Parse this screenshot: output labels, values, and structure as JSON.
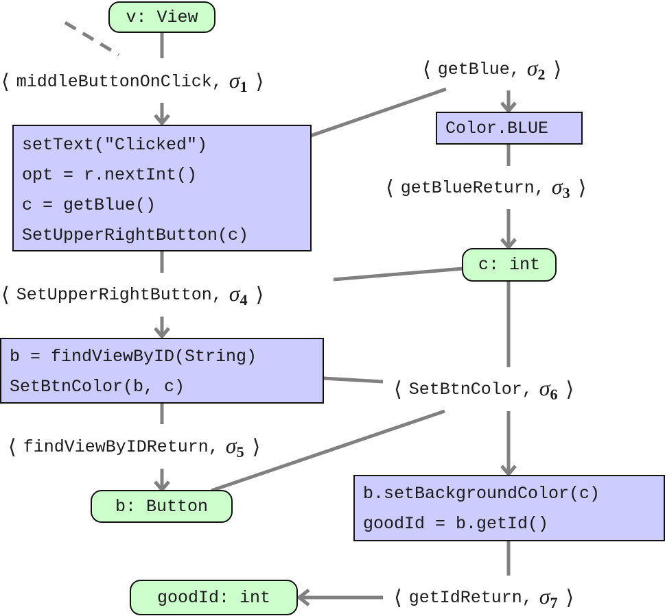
{
  "diagram": {
    "colors": {
      "variable_node_fill": "#ccffcc",
      "statement_node_fill": "#ccccff",
      "edge": "#808080",
      "border": "#111111"
    },
    "variable_nodes": {
      "v_view": "v: View",
      "c_int": "c: int",
      "b_button": "b: Button",
      "goodid_int": "goodId: int"
    },
    "statement_nodes": {
      "middle_block": [
        "setText(\"Clicked\")",
        "opt = r.nextInt()",
        "c = getBlue()",
        "SetUpperRightButton(c)"
      ],
      "color_blue": [
        "Color.BLUE"
      ],
      "find_view_block": [
        "b = findViewByID(String)",
        "SetBtnColor(b, c)"
      ],
      "set_bg_block": [
        "b.setBackgroundColor(c)",
        "goodId = b.getId()"
      ]
    },
    "edge_labels": [
      {
        "event": "middleButtonOnClick",
        "sigma": "σ",
        "index": "1"
      },
      {
        "event": "getBlue",
        "sigma": "σ",
        "index": "2"
      },
      {
        "event": "getBlueReturn",
        "sigma": "σ",
        "index": "3"
      },
      {
        "event": "SetUpperRightButton",
        "sigma": "σ",
        "index": "4"
      },
      {
        "event": "findViewByIDReturn",
        "sigma": "σ",
        "index": "5"
      },
      {
        "event": "SetBtnColor",
        "sigma": "σ",
        "index": "6"
      },
      {
        "event": "getIdReturn",
        "sigma": "σ",
        "index": "7"
      }
    ],
    "brackets": {
      "open": "⟨",
      "close": "⟩",
      "separator": ","
    }
  }
}
